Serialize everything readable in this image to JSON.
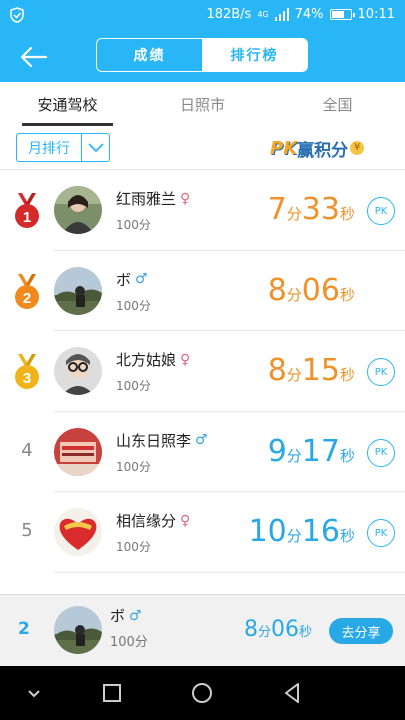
{
  "status": {
    "speed": "182B/s",
    "network": "4G",
    "battery": "74%",
    "battery_level": 0.74,
    "time": "10:11"
  },
  "header": {
    "segments": [
      {
        "label": "成绩"
      },
      {
        "label": "排行榜"
      }
    ],
    "active_segment": "排行榜"
  },
  "tabs": [
    {
      "label": "安通驾校"
    },
    {
      "label": "日照市"
    },
    {
      "label": "全国"
    }
  ],
  "active_tab": "安通驾校",
  "filter": {
    "period": "月排行",
    "banner_pk": "PK",
    "banner_text": "赢积分",
    "banner_coin": "¥"
  },
  "pk_label": "PK",
  "ranking": [
    {
      "rank": "1",
      "name": "红雨雅兰",
      "gender": "♀",
      "score": "100分",
      "min": "7",
      "sec": "33",
      "min_unit": "分",
      "sec_unit": "秒"
    },
    {
      "rank": "2",
      "name": "ボ",
      "gender": "♂",
      "score": "100分",
      "min": "8",
      "sec": "06",
      "min_unit": "分",
      "sec_unit": "秒"
    },
    {
      "rank": "3",
      "name": "北方姑娘",
      "gender": "♀",
      "score": "100分",
      "min": "8",
      "sec": "15",
      "min_unit": "分",
      "sec_unit": "秒"
    },
    {
      "rank": "4",
      "name": "山东日照李",
      "gender": "♂",
      "score": "100分",
      "min": "9",
      "sec": "17",
      "min_unit": "分",
      "sec_unit": "秒"
    },
    {
      "rank": "5",
      "name": "相信缘分",
      "gender": "♀",
      "score": "100分",
      "min": "10",
      "sec": "16",
      "min_unit": "分",
      "sec_unit": "秒"
    }
  ],
  "me": {
    "rank": "2",
    "name": "ボ",
    "gender": "♂",
    "score": "100分",
    "min": "8",
    "sec": "06",
    "min_unit": "分",
    "sec_unit": "秒",
    "share_label": "去分享"
  },
  "colors": {
    "primary": "#29b6f6",
    "orange": "#f0922b",
    "blue": "#29a8e6",
    "female": "#e06b7d",
    "male": "#3aa3e3"
  }
}
